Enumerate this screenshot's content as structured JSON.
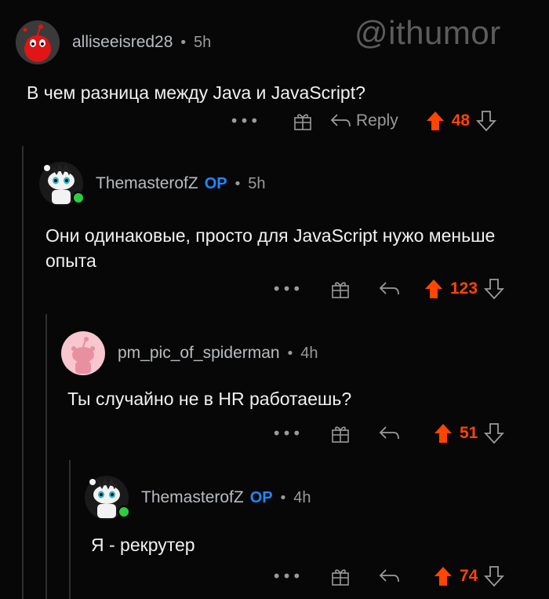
{
  "watermark": "@ithumor",
  "comments": [
    {
      "username": "alliseeisred28",
      "op": "",
      "time": "5h",
      "text": "В чем разница между Java и JavaScript?",
      "reply_label": "Reply",
      "score": "48"
    },
    {
      "username": "ThemasterofZ",
      "op": "OP",
      "time": "5h",
      "text": "Они одинаковые, просто для JavaScript нужо меньше опыта",
      "reply_label": "",
      "score": "123"
    },
    {
      "username": "pm_pic_of_spiderman",
      "op": "",
      "time": "4h",
      "text": "Ты случайно не в HR работаешь?",
      "reply_label": "",
      "score": "51"
    },
    {
      "username": "ThemasterofZ",
      "op": "OP",
      "time": "4h",
      "text": "Я - рекрутер",
      "reply_label": "",
      "score": "74"
    }
  ],
  "separator": "•",
  "more_glyph": "•••",
  "icons": {
    "more": "more-icon",
    "award": "award-gift-icon",
    "reply": "reply-arrow-icon",
    "upvote": "upvote-arrow-icon",
    "downvote": "downvote-arrow-icon"
  },
  "colors": {
    "upvote": "#ff4500",
    "op": "#1e88ff",
    "online": "#2ecc40",
    "background": "#070707"
  }
}
